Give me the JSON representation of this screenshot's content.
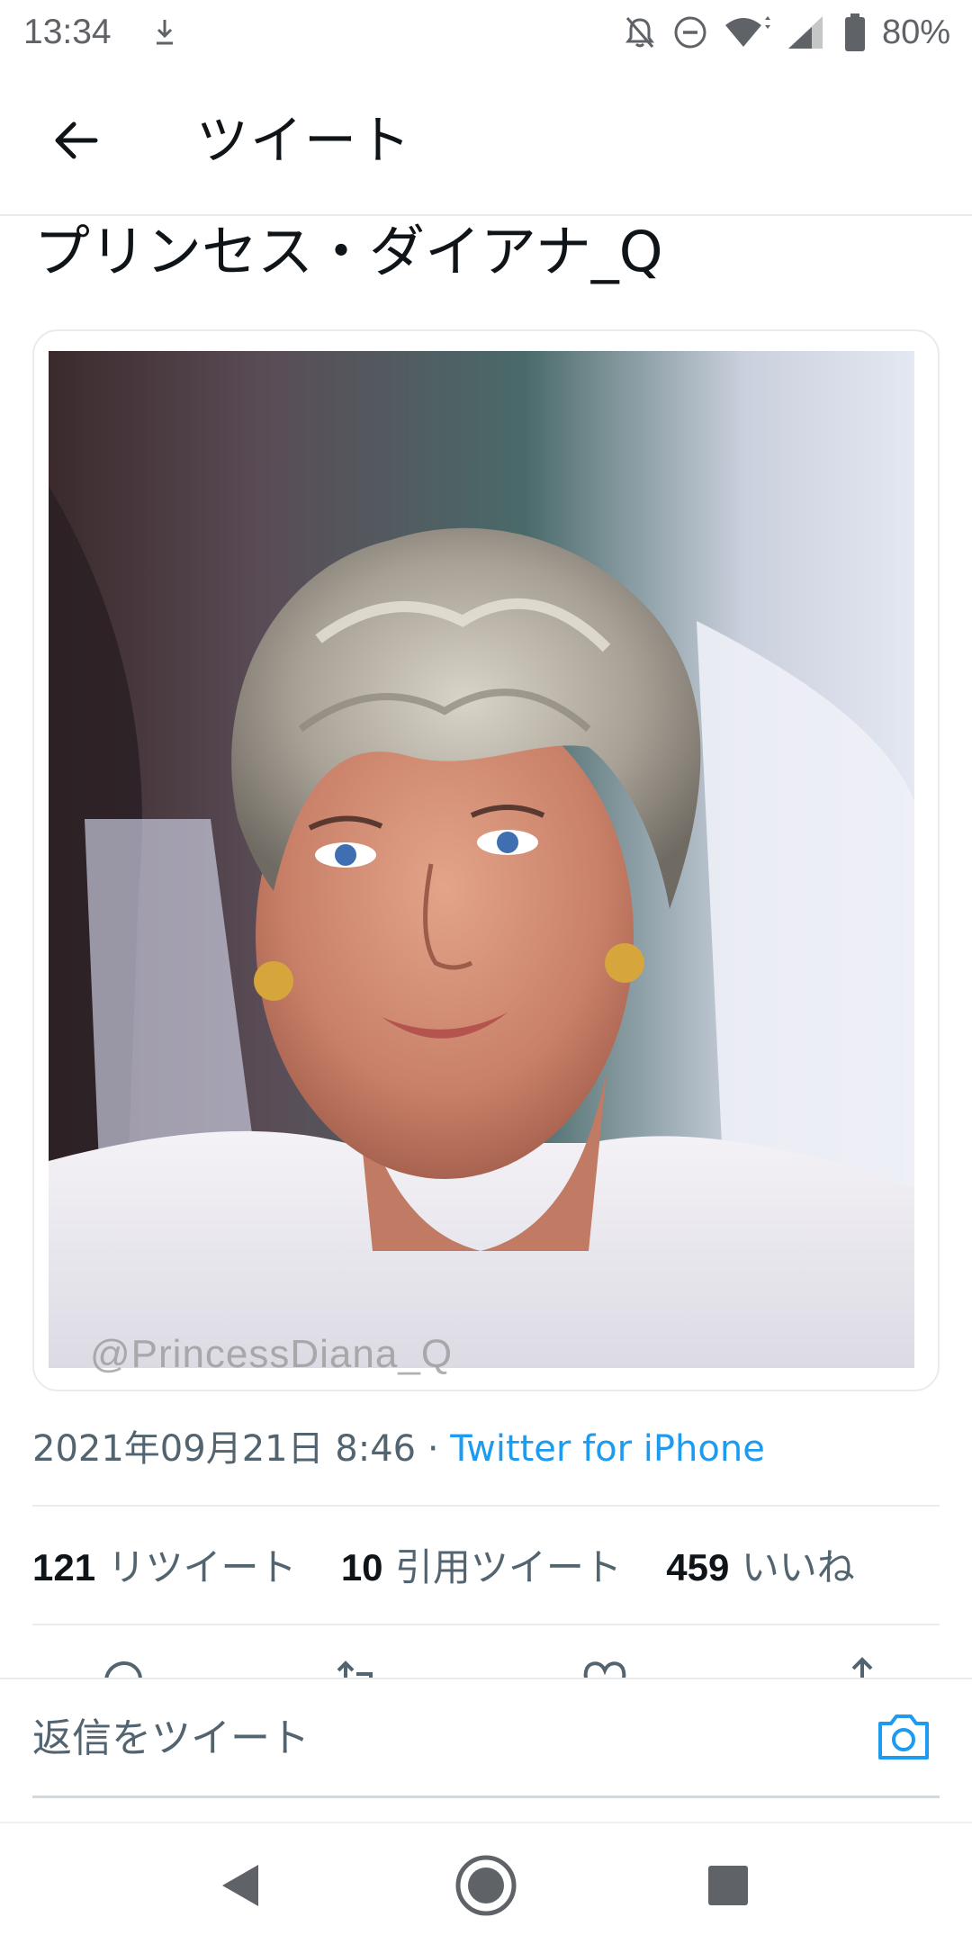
{
  "status_bar": {
    "time": "13:34",
    "battery": "80%"
  },
  "app_bar": {
    "title": "ツイート"
  },
  "tweet": {
    "text": "プリンセス・ダイアナ_Q",
    "image_watermark": "@PrincessDiana_Q",
    "timestamp": "2021年09月21日 8:46",
    "separator": "·",
    "source": "Twitter for iPhone"
  },
  "stats": {
    "retweets_count": "121",
    "retweets_label": "リツイート",
    "quotes_count": "10",
    "quotes_label": "引用ツイート",
    "likes_count": "459",
    "likes_label": "いいね"
  },
  "reply": {
    "placeholder": "返信をツイート"
  },
  "icons": {
    "accent": "#1d9bf0",
    "status": [
      "download-icon",
      "notifications-off-icon",
      "dnd-icon",
      "wifi-icon",
      "cellular-signal-icon",
      "battery-icon"
    ],
    "actions": [
      "reply-icon",
      "retweet-icon",
      "like-icon",
      "share-icon"
    ],
    "nav": [
      "back-triangle-icon",
      "home-circle-icon",
      "recents-square-icon"
    ]
  }
}
